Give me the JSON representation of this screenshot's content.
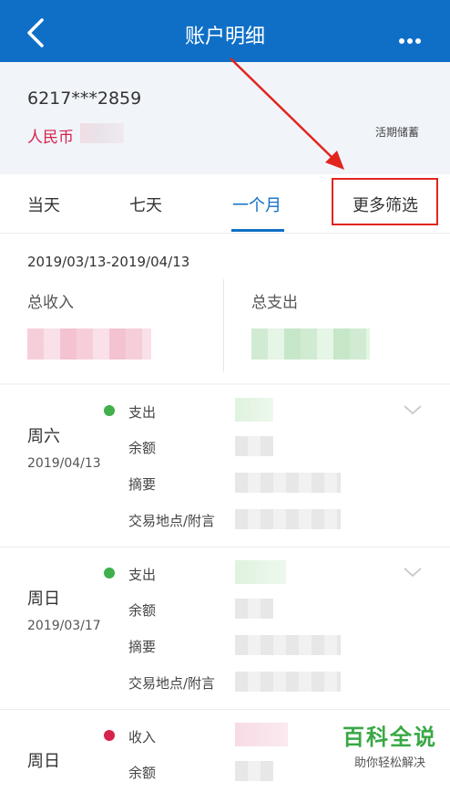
{
  "header": {
    "title": "账户明细"
  },
  "account": {
    "number": "6217***2859",
    "currency": "人民币",
    "type": "活期储蓄"
  },
  "tabs": [
    {
      "label": "当天"
    },
    {
      "label": "七天"
    },
    {
      "label": "一个月",
      "active": true
    }
  ],
  "filter": {
    "label": "更多筛选"
  },
  "summary": {
    "date_range": "2019/03/13-2019/04/13",
    "income_label": "总收入",
    "expense_label": "总支出"
  },
  "row_labels": {
    "balance": "余额",
    "memo": "摘要",
    "location": "交易地点/附言"
  },
  "transactions": [
    {
      "weekday": "周六",
      "date": "2019/04/13",
      "type": "支出",
      "dot_color": "#3fb04a"
    },
    {
      "weekday": "周日",
      "date": "2019/03/17",
      "type": "支出",
      "dot_color": "#3fb04a"
    },
    {
      "weekday": "周日",
      "date": "",
      "type": "收入",
      "dot_color": "#d6234b"
    }
  ],
  "colors": {
    "brand": "#0f6fc6",
    "highlight": "#e2241f",
    "income": "#d6234b",
    "expense": "#3fb04a"
  },
  "watermark": {
    "title": "百科全说",
    "subtitle": "助你轻松解决"
  }
}
